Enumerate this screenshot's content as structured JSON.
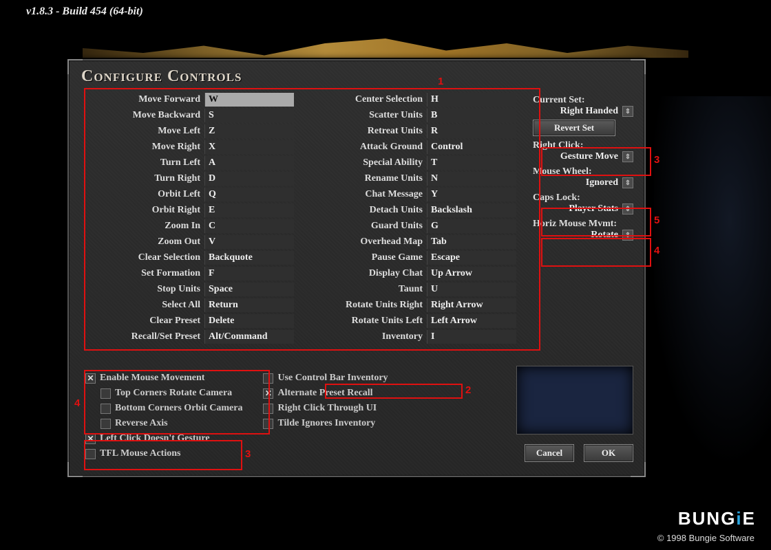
{
  "version": "v1.8.3  -  Build 454 (64-bit)",
  "panel_title": "Configure Controls",
  "bindings_left": [
    {
      "label": "Move Forward",
      "value": "W",
      "active": true
    },
    {
      "label": "Move Backward",
      "value": "S"
    },
    {
      "label": "Move Left",
      "value": "Z"
    },
    {
      "label": "Move Right",
      "value": "X"
    },
    {
      "label": "Turn Left",
      "value": "A"
    },
    {
      "label": "Turn Right",
      "value": "D"
    },
    {
      "label": "Orbit Left",
      "value": "Q"
    },
    {
      "label": "Orbit Right",
      "value": "E"
    },
    {
      "label": "Zoom In",
      "value": "C"
    },
    {
      "label": "Zoom Out",
      "value": "V"
    },
    {
      "label": "Clear Selection",
      "value": "Backquote"
    },
    {
      "label": "Set Formation",
      "value": "F"
    },
    {
      "label": "Stop Units",
      "value": "Space"
    },
    {
      "label": "Select All",
      "value": "Return"
    },
    {
      "label": "Clear Preset",
      "value": "Delete"
    },
    {
      "label": "Recall/Set Preset",
      "value": "Alt/Command"
    }
  ],
  "bindings_right": [
    {
      "label": "Center Selection",
      "value": "H"
    },
    {
      "label": "Scatter Units",
      "value": "B"
    },
    {
      "label": "Retreat Units",
      "value": "R"
    },
    {
      "label": "Attack Ground",
      "value": "Control"
    },
    {
      "label": "Special Ability",
      "value": "T"
    },
    {
      "label": "Rename Units",
      "value": "N"
    },
    {
      "label": "Chat Message",
      "value": "Y"
    },
    {
      "label": "Detach Units",
      "value": "Backslash"
    },
    {
      "label": "Guard Units",
      "value": "G"
    },
    {
      "label": "Overhead Map",
      "value": "Tab"
    },
    {
      "label": "Pause Game",
      "value": "Escape"
    },
    {
      "label": "Display Chat",
      "value": "Up Arrow"
    },
    {
      "label": "Taunt",
      "value": "U"
    },
    {
      "label": "Rotate Units Right",
      "value": "Right Arrow"
    },
    {
      "label": "Rotate Units Left",
      "value": "Left Arrow"
    },
    {
      "label": "Inventory",
      "value": "I"
    }
  ],
  "right": {
    "current_set_label": "Current Set:",
    "current_set_value": "Right Handed",
    "revert": "Revert Set",
    "right_click_label": "Right Click:",
    "right_click_value": "Gesture Move",
    "wheel_label": "Mouse Wheel:",
    "wheel_value": "Ignored",
    "caps_label": "Caps Lock:",
    "caps_value": "Player Stats",
    "horiz_label": "Horiz Mouse Mvmt:",
    "horiz_value": "Rotate"
  },
  "checks_left": [
    {
      "label": "Enable Mouse Movement",
      "checked": true,
      "indent": false
    },
    {
      "label": "Top Corners Rotate Camera",
      "checked": false,
      "indent": true
    },
    {
      "label": "Bottom Corners Orbit Camera",
      "checked": false,
      "indent": true
    },
    {
      "label": "Reverse Axis",
      "checked": false,
      "indent": true
    },
    {
      "label": "Left Click Doesn't Gesture",
      "checked": true,
      "indent": false
    },
    {
      "label": "TFL Mouse Actions",
      "checked": false,
      "indent": false
    }
  ],
  "checks_right": [
    {
      "label": "Use Control Bar Inventory",
      "checked": false
    },
    {
      "label": "Alternate Preset Recall",
      "checked": true
    },
    {
      "label": "Right Click Through UI",
      "checked": false
    },
    {
      "label": "Tilde Ignores Inventory",
      "checked": false
    }
  ],
  "buttons": {
    "cancel": "Cancel",
    "ok": "OK"
  },
  "logo": "BUNGiE",
  "copyright": "© 1998 Bungie Software",
  "annotations": [
    "1",
    "2",
    "3",
    "4",
    "5"
  ]
}
